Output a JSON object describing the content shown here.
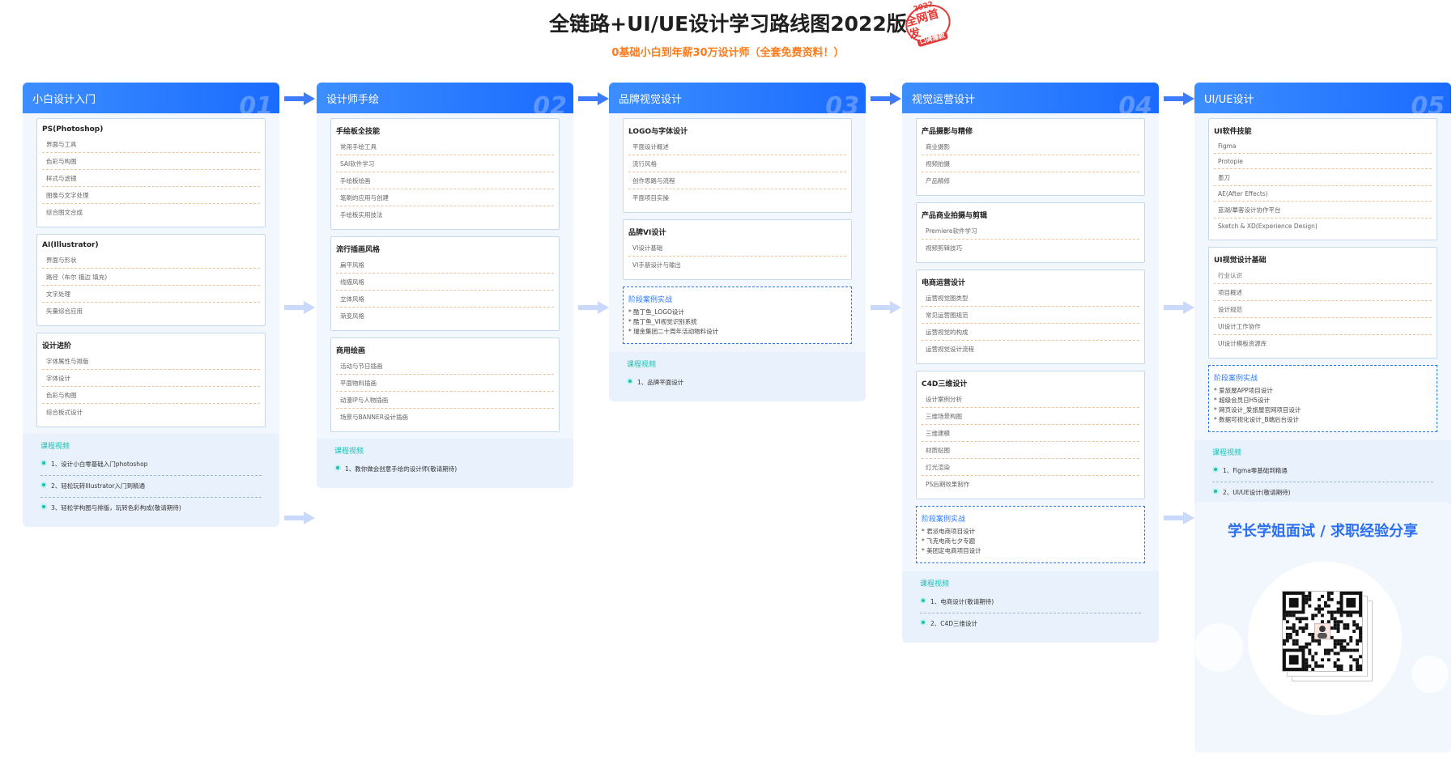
{
  "header": {
    "title": "全链路+UI/UE设计学习路线图2022版",
    "subtitle": "0基础小白到年薪30万设计师（全套免费资料！）",
    "badge": {
      "line1": "2022",
      "line2": "全网首发",
      "line3": "口碑爆款"
    }
  },
  "columns": [
    {
      "title": "小白设计入门",
      "num": "01",
      "modules": [
        {
          "title": "PS(Photoshop)",
          "items": [
            "界面与工具",
            "色彩与构图",
            "样式与滤镜",
            "图像与文字处理",
            "综合图文合成"
          ]
        },
        {
          "title": "AI(Illustrator)",
          "items": [
            "界面与形状",
            "路径（布尔 描边 填充)",
            "文字处理",
            "矢量综合应用"
          ]
        },
        {
          "title": "设计进阶",
          "items": [
            "字体属性与排版",
            "字体设计",
            "色彩与构图",
            "综合板式设计"
          ]
        }
      ],
      "practice": null,
      "lessons_title": "课程视频",
      "lessons": [
        "1、设计小白零基础入门photoshop",
        "2、轻松玩转Illustrator入门到精通",
        "3、轻松学构图与排版，玩转色彩构成(敬请期待)"
      ]
    },
    {
      "title": "设计师手绘",
      "num": "02",
      "modules": [
        {
          "title": "手绘板全技能",
          "items": [
            "常用手绘工具",
            "SAI软件学习",
            "手绘板绘画",
            "笔刷的应用与创建",
            "手绘板实用技法"
          ]
        },
        {
          "title": "流行插画风格",
          "items": [
            "扁平风格",
            "线描风格",
            "立体风格",
            "渐变风格"
          ]
        },
        {
          "title": "商用绘画",
          "items": [
            "活动与节日插画",
            "平面物料插画",
            "动漫IP与人物插画",
            "场景与BANNER设计插画"
          ]
        }
      ],
      "practice": null,
      "lessons_title": "课程视频",
      "lessons": [
        "1、教你做会创意手绘的设计师(敬请期待)"
      ]
    },
    {
      "title": "品牌视觉设计",
      "num": "03",
      "modules": [
        {
          "title": "LOGO与字体设计",
          "items": [
            "平面设计概述",
            "流行风格",
            "创作思路与流程",
            "平面项目实操"
          ]
        },
        {
          "title": "品牌VI设计",
          "items": [
            "VI设计基础",
            "VI手册设计与输出"
          ]
        }
      ],
      "practice": {
        "title": "阶段案例实战",
        "items": [
          "* 酷丁鱼_LOGO设计",
          "* 酷丁鱼_VI视觉识别系统",
          "* 瑞金集团二十周年活动物料设计"
        ]
      },
      "lessons_title": "课程视频",
      "lessons": [
        "1、品牌平面设计"
      ]
    },
    {
      "title": "视觉运营设计",
      "num": "04",
      "modules": [
        {
          "title": "产品摄影与精修",
          "items": [
            "商业摄影",
            "视频拍摄",
            "产品精修"
          ]
        },
        {
          "title": "产品商业拍摄与剪辑",
          "items": [
            "Premiere软件学习",
            "视频剪辑技巧"
          ]
        },
        {
          "title": "电商运营设计",
          "items": [
            "运营视觉图类型",
            "常见运营图规范",
            "运营视觉的构成",
            "运营视觉设计流程"
          ]
        },
        {
          "title": "C4D三维设计",
          "items": [
            "设计案例分析",
            "三维场景构图",
            "三维建模",
            "材质贴图",
            "灯光渲染",
            "PS后期效果制作"
          ]
        }
      ],
      "practice": {
        "title": "阶段案例实战",
        "items": [
          "* 君派电商项目设计",
          "* 飞克电商七夕专题",
          "* 美团定电商项目设计"
        ]
      },
      "lessons_title": "课程视频",
      "lessons": [
        "1、电商设计(敬请期待)",
        "2、C4D三维设计"
      ]
    },
    {
      "title": "UI/UE设计",
      "num": "05",
      "modules": [
        {
          "title": "UI软件技能",
          "items": [
            "Figma",
            "Protopie",
            "墨刀",
            "AE(After Effects)",
            "蓝湖/摹客设计协作平台",
            "Sketch & XD(Experience Design)"
          ]
        },
        {
          "title": "UI视觉设计基础",
          "items": [
            "行业认识",
            "项目概述",
            "设计规范",
            "UI设计工作协作",
            "UI设计模板资源库"
          ]
        }
      ],
      "practice": {
        "title": "阶段案例实战",
        "items": [
          "* 爱旅屋APP项目设计",
          "* 超级会员日H5设计",
          "* 网页设计_爱旅屋官网项目设计",
          "* 数据可视化设计_B端后台设计"
        ]
      },
      "lessons_title": "课程视频",
      "lessons": [
        "1、Figma零基础到精通",
        "2、UI/UE设计(敬请期待)"
      ]
    }
  ],
  "share": {
    "title": "学长学姐面试 / 求职经验分享"
  },
  "colors": {
    "header_blue": "#1a6bff",
    "accent_orange": "#ff7a1a",
    "lesson_teal": "#17c2b4",
    "badge_red": "#e53935"
  }
}
